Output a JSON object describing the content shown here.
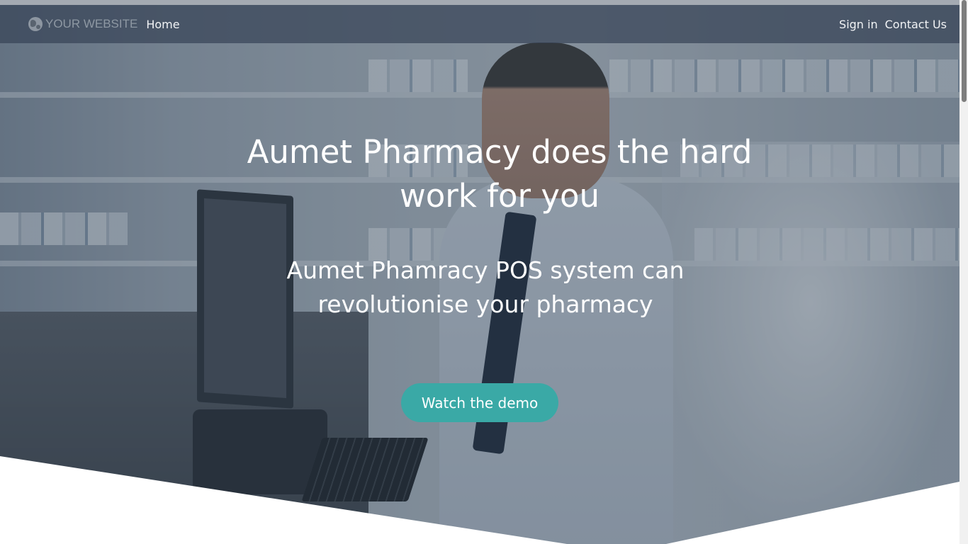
{
  "navbar": {
    "brand": "YOUR WEBSITE",
    "home": "Home",
    "sign_in": "Sign in",
    "contact": "Contact Us",
    "brand_icon": "globe-icon"
  },
  "hero": {
    "headline": "Aumet Pharmacy does the hard work for you",
    "subheadline": "Aumet Phamracy POS system can revolutionise your pharmacy",
    "cta_label": "Watch the demo"
  },
  "colors": {
    "accent": "#3aa9a6",
    "navbar_bg": "#374458",
    "overlay": "#2c3e50"
  }
}
